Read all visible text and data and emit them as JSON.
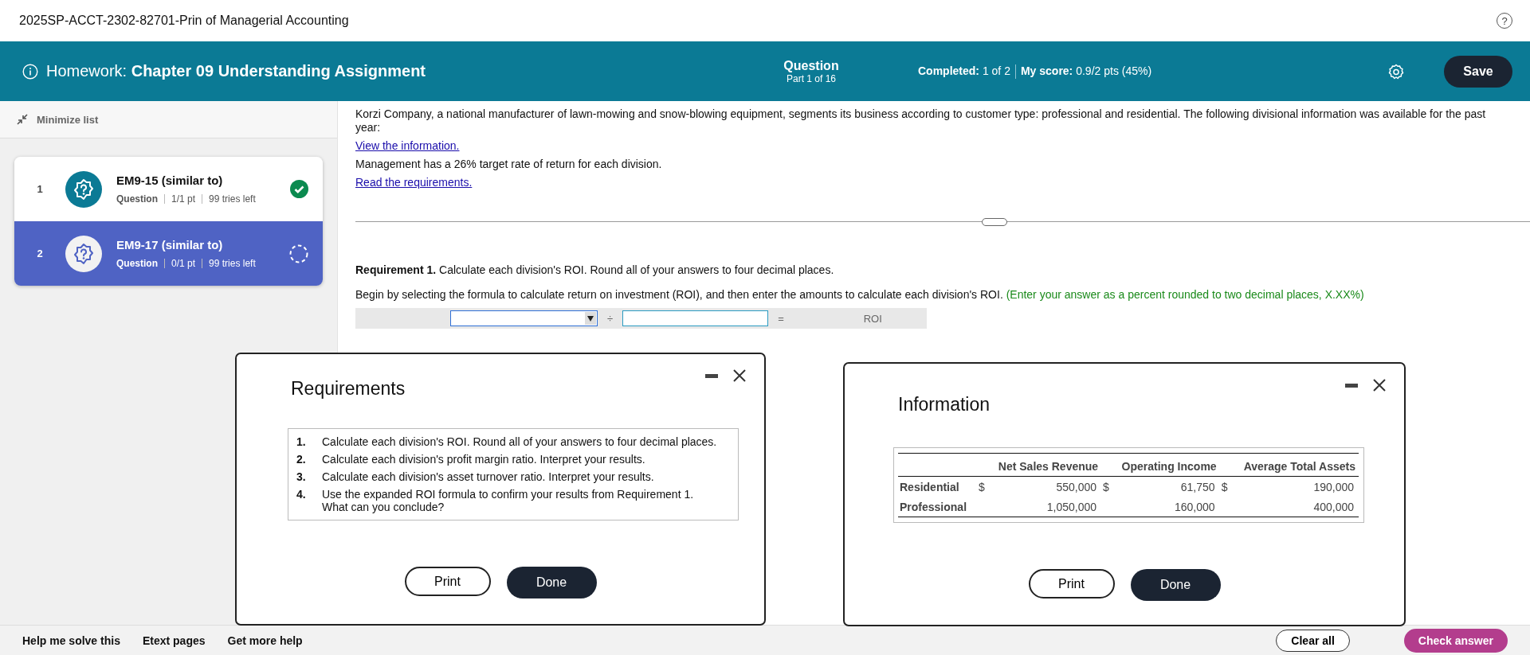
{
  "course_title": "2025SP-ACCT-2302-82701-Prin of Managerial Accounting",
  "help_icon": "?",
  "header": {
    "label": "Homework:",
    "assignment": "Chapter 09 Understanding Assignment",
    "question_label": "Question",
    "part": "Part 1 of 16",
    "completed_label": "Completed:",
    "completed": "1 of 2",
    "score_label": "My score:",
    "score": "0.9/2 pts (45%)",
    "save": "Save"
  },
  "sidebar": {
    "minimize": "Minimize list",
    "items": [
      {
        "number": "1",
        "title": "EM9-15 (similar to)",
        "type": "Question",
        "points": "1/1 pt",
        "tries": "99 tries left",
        "selected": false,
        "correct": true
      },
      {
        "number": "2",
        "title": "EM9-17 (similar to)",
        "type": "Question",
        "points": "0/1 pt",
        "tries": "99 tries left",
        "selected": true,
        "correct": false
      }
    ]
  },
  "problem": [
    {
      "kind": "text",
      "text": "Korzi Company, a national manufacturer of lawn-mowing and snow-blowing equipment, segments its business according to customer type: professional and residential. The following divisional information was available for the past year:"
    },
    {
      "kind": "link",
      "text": "View the information."
    },
    {
      "kind": "text",
      "text": "Management has a 26% target rate of return for each division."
    },
    {
      "kind": "link",
      "text": "Read the requirements."
    }
  ],
  "requirement": "**Requirement 1.** Calculate each division's ROI. Round all of your answers to four decimal places.",
  "instruction": "Begin by selecting the formula to calculate return on investment (ROI), and then enter the amounts to calculate each division's ROI.",
  "hint": "(Enter your answer as a percent rounded to two decimal places, X.XX%)",
  "formula": {
    "operator": "÷",
    "equals": "=",
    "result": "ROI"
  },
  "requirements_dialog": {
    "title": "Requirements",
    "items": [
      {
        "number": "1.",
        "text": "Calculate each division's ROI. Round all of your answers to four decimal places."
      },
      {
        "number": "2.",
        "text": "Calculate each division's profit margin ratio. Interpret your results."
      },
      {
        "number": "3.",
        "text": "Calculate each division's asset turnover ratio. Interpret your results."
      },
      {
        "number": "4.",
        "text": "Use the expanded ROI formula to confirm your results from Requirement 1. What can you conclude?"
      }
    ],
    "print": "Print",
    "done": "Done"
  },
  "information_dialog": {
    "title": "Information",
    "columns": [
      "Net Sales Revenue",
      "Operating Income",
      "Average Total Assets"
    ],
    "rows": [
      {
        "label": "Residential",
        "cells": [
          {
            "currency": "$",
            "value": "550,000"
          },
          {
            "currency": "$",
            "value": "61,750"
          },
          {
            "currency": "$",
            "value": "190,000"
          }
        ]
      },
      {
        "label": "Professional",
        "cells": [
          {
            "value": "1,050,000"
          },
          {
            "value": "160,000"
          },
          {
            "value": "400,000"
          }
        ]
      }
    ],
    "print": "Print",
    "done": "Done"
  },
  "footer": {
    "links": [
      "Help me solve this",
      "Etext pages",
      "Get more help"
    ],
    "clear": "Clear all",
    "check": "Check answer"
  }
}
